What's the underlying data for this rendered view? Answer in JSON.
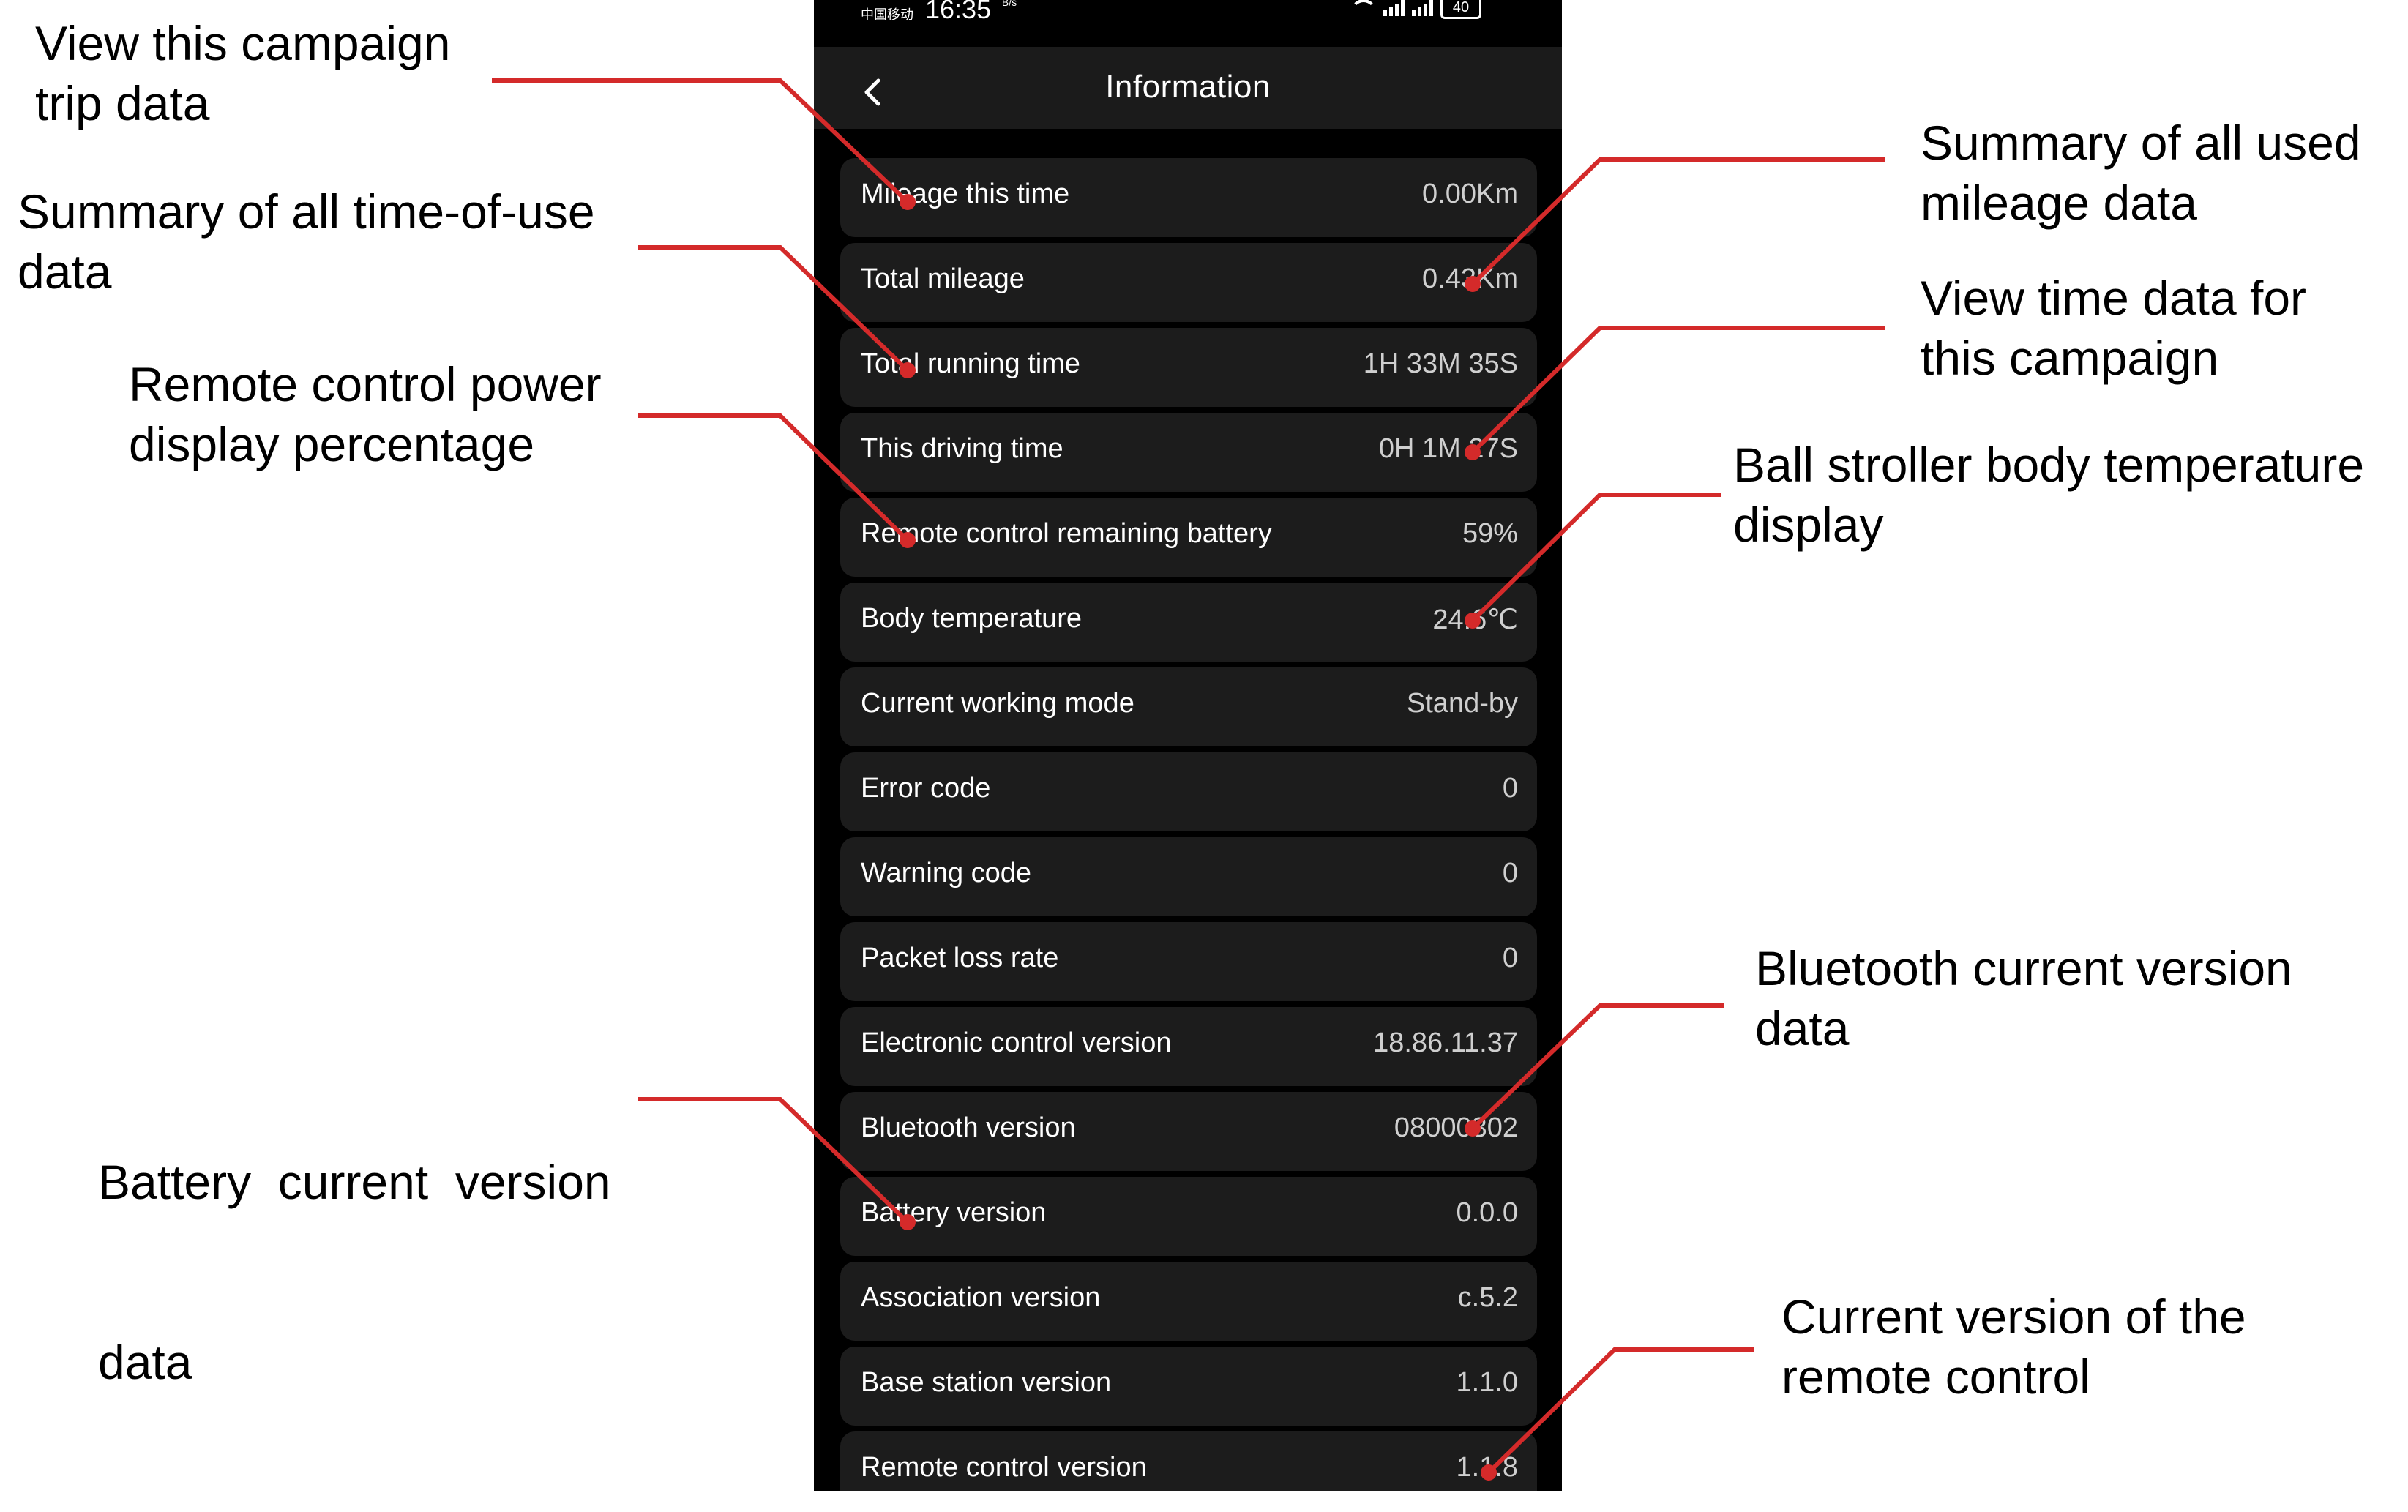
{
  "status_bar": {
    "carrier": "中国移动",
    "time": "16:35",
    "speed": "B/s",
    "network": "5G",
    "battery": "40"
  },
  "header": {
    "title": "Information"
  },
  "rows": [
    {
      "label": "Mileage this time",
      "value": "0.00Km"
    },
    {
      "label": "Total mileage",
      "value": "0.43Km"
    },
    {
      "label": "Total running time",
      "value": "1H 33M 35S"
    },
    {
      "label": "This driving time",
      "value": "0H 1M 27S"
    },
    {
      "label": "Remote control remaining battery",
      "value": "59%"
    },
    {
      "label": "Body temperature",
      "value": "24.6℃"
    },
    {
      "label": "Current working mode",
      "value": "Stand-by"
    },
    {
      "label": "Error code",
      "value": "0"
    },
    {
      "label": "Warning code",
      "value": "0"
    },
    {
      "label": "Packet loss rate",
      "value": "0"
    },
    {
      "label": "Electronic control version",
      "value": "18.86.11.37"
    },
    {
      "label": "Bluetooth version",
      "value": "08000302"
    },
    {
      "label": "Battery version",
      "value": "0.0.0"
    },
    {
      "label": "Association version",
      "value": "c.5.2"
    },
    {
      "label": "Base station version",
      "value": "1.1.0"
    },
    {
      "label": "Remote control version",
      "value": "1.1.8"
    }
  ],
  "annotations": {
    "campaign_trip": [
      "View this campaign",
      "trip data"
    ],
    "time_of_use": [
      "Summary of all time-of-use",
      "data"
    ],
    "remote_power": [
      "Remote control power",
      "display percentage"
    ],
    "battery_version": [
      "Battery  current  version",
      "data"
    ],
    "used_mileage": [
      "Summary of all used",
      "mileage data"
    ],
    "campaign_time": [
      "View time data for",
      "this campaign"
    ],
    "body_temperature": [
      "Ball stroller body temperature",
      "display"
    ],
    "bluetooth_version": [
      "Bluetooth current version",
      "data"
    ],
    "remote_version": [
      "Current version of the",
      "remote control"
    ]
  },
  "colors": {
    "leader": "#d42a2a",
    "row_bg": "#1c1c1c",
    "header_bg": "#1b1b1b"
  }
}
